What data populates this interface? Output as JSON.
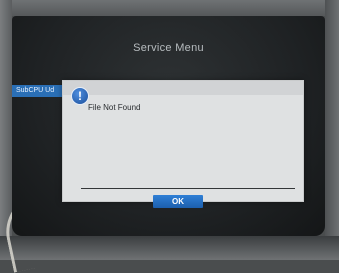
{
  "window": {
    "title": "Service Menu"
  },
  "menu": {
    "selected_item": "SubCPU Ud"
  },
  "dialog": {
    "message": "File Not Found",
    "ok_label": "OK",
    "icon": "info-icon"
  }
}
